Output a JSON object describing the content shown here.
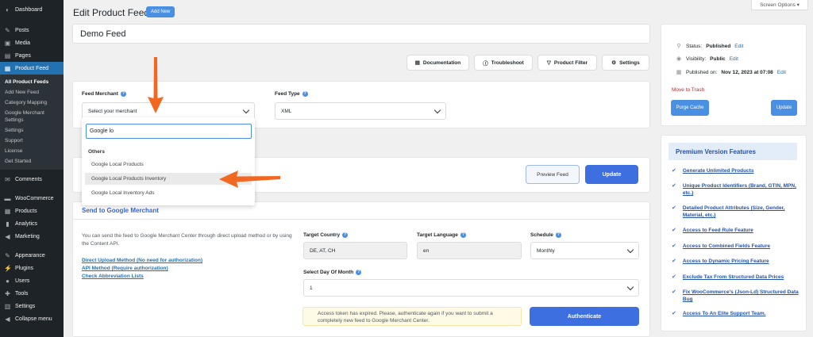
{
  "sidebar": {
    "top_items": [
      {
        "label": "Dashboard",
        "icon": "dashboard-icon",
        "glyph": "◐"
      },
      {
        "label": "Posts",
        "icon": "pin-icon",
        "glyph": "✎"
      },
      {
        "label": "Media",
        "icon": "media-icon",
        "glyph": "▣"
      },
      {
        "label": "Pages",
        "icon": "pages-icon",
        "glyph": "▤"
      },
      {
        "label": "Product Feed",
        "icon": "feed-icon",
        "glyph": "▦"
      }
    ],
    "submenu": [
      "All Product Feeds",
      "Add New Feed",
      "Category Mapping",
      "Google Merchant Settings",
      "Settings",
      "Support",
      "License",
      "Get Started"
    ],
    "bottom_items": [
      {
        "label": "Comments",
        "icon": "comments-icon",
        "glyph": "✉"
      },
      {
        "label": "WooCommerce",
        "icon": "woo-icon",
        "glyph": "▬"
      },
      {
        "label": "Products",
        "icon": "products-icon",
        "glyph": "▦"
      },
      {
        "label": "Analytics",
        "icon": "analytics-icon",
        "glyph": "▮"
      },
      {
        "label": "Marketing",
        "icon": "marketing-icon",
        "glyph": "◀"
      },
      {
        "label": "Appearance",
        "icon": "appearance-icon",
        "glyph": "✎"
      },
      {
        "label": "Plugins",
        "icon": "plugins-icon",
        "glyph": "⚡"
      },
      {
        "label": "Users",
        "icon": "users-icon",
        "glyph": "●"
      },
      {
        "label": "Tools",
        "icon": "tools-icon",
        "glyph": "✚"
      },
      {
        "label": "Settings",
        "icon": "settings-icon",
        "glyph": "▥"
      },
      {
        "label": "Collapse menu",
        "icon": "collapse-icon",
        "glyph": "◀"
      }
    ]
  },
  "header": {
    "title": "Edit Product Feed",
    "add_new": "Add New",
    "screen_options": "Screen Options ▾"
  },
  "feed_name": "Demo Feed",
  "toolbar": {
    "documentation": "Documentation",
    "troubleshoot": "Troubleshoot",
    "product_filter": "Product Filter",
    "settings": "Settings"
  },
  "merchant": {
    "label": "Feed Merchant",
    "placeholder": "Select your merchant",
    "search_value": "Google lo",
    "group": "Others",
    "options": [
      "Google Local Products",
      "Google Local Products Inventory",
      "Google Local Inventory Ads"
    ]
  },
  "feed_type": {
    "label": "Feed Type",
    "value": "XML"
  },
  "actions": {
    "preview": "Preview Feed",
    "update": "Update"
  },
  "google": {
    "title": "Send to Google Merchant",
    "description": "You can send the feed to Google Merchant Center through direct upload method or by using the Content API.",
    "link_direct": "Direct Upload Method (No need for authorization)",
    "link_api": "API Method (Require authorization)",
    "link_abbrev": "Check Abbreviation Lists",
    "target_country_label": "Target Country",
    "target_country": "DE, AT, CH",
    "target_language_label": "Target Language",
    "target_language": "en",
    "schedule_label": "Schedule",
    "schedule": "Monthly",
    "day_label": "Select Day Of Month",
    "day": "1",
    "notice": "Access token has expired. Please, authenticate again if you want to submit a completely new feed to Google Merchant Center.",
    "authenticate": "Authenticate"
  },
  "publish": {
    "status_label": "Status:",
    "status": "Published",
    "visibility_label": "Visibility:",
    "visibility": "Public",
    "published_label": "Published on:",
    "published": "Nov 12, 2023 at 07:08",
    "edit": "Edit",
    "trash": "Move to Trash",
    "purge": "Purge Cache",
    "update": "Update"
  },
  "premium": {
    "title": "Premium Version Features",
    "features": [
      "Generate Unlimited Products",
      "Unique Product Identifiers (Brand, GTIN, MPN, etc.)",
      "Detailed Product Attributes (Size, Gender, Material, etc.)",
      "Access to Feed Rule Feature",
      "Access to Combined Fields Feature",
      "Access to Dynamic Pricing Feature",
      "Exclude Tax From Structured Data Prices",
      "Fix WooCommerce's (Json-Ld) Structured Data Bug",
      "Access To An Elite Support Team."
    ]
  },
  "colors": {
    "accent": "#3e6fe0",
    "arrow": "#f26722",
    "sidebar": "#1d2327"
  }
}
